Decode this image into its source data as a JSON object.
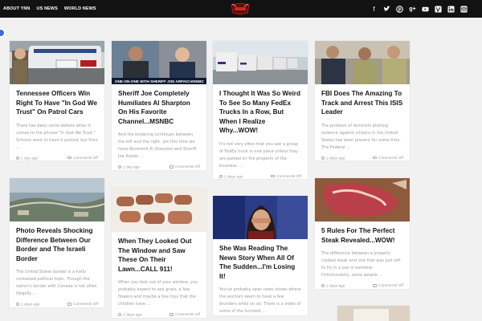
{
  "nav": {
    "items": [
      "ABOUT YNN",
      "US NEWS",
      "WORLD NEWS"
    ]
  },
  "logo": {
    "icon": "ynn-logo"
  },
  "social": [
    "facebook-icon",
    "twitter-icon",
    "pinterest-icon",
    "google-plus-icon",
    "youtube-icon",
    "vine-icon",
    "linkedin-icon",
    "email-icon"
  ],
  "articles": [
    {
      "title": "Tennessee Officers Win Right To Have \"In God We Trust\" On Patrol Cars",
      "excerpt": "There has been some debate when it comes to the phrase \"In God We Trust.\" Schools want to have it posted, but their ...",
      "date": "1 day ago",
      "comments": "Comments Off"
    },
    {
      "title": "Sheriff Joe Completely Humiliates Al Sharpton On His Favorite Channel...MSNBC",
      "thumb_caption": "ONE-ON-ONE WITH SHERIFF JOE ARPAIO",
      "thumb_logo": "MSNBC",
      "excerpt": "And the bickering continues between the left and the right, yet this time we have Reverend Al Sharpton and Sheriff Joe Arpaio ...",
      "date": "1 day ago",
      "comments": "Comments Off"
    },
    {
      "title": "I Thought It Was So Weird To See So Many FedEx Trucks In a Row, But When I Realize Why...WOW!",
      "excerpt": "It's not very often that you see a group of FedEx truck in one place unless they are parked on the property of the business. ...",
      "date": "2 days ago",
      "comments": "Comments Off"
    },
    {
      "title": "FBI Does The Amazing To Track and Arrest This ISIS Leader",
      "excerpt": "The problem of terrorists plotting violence against citizens in the United States has been present for some time. The Federal ...",
      "date": "2 days ago",
      "comments": "Comments Off"
    },
    {
      "title": "Photo Reveals Shocking Difference Between Our Border and The Israeli Border",
      "excerpt": "The United States border is a hotly contested political topic. Though the nation's border with Canada is not often illegally ...",
      "date": "2 days ago",
      "comments": "Comments Off"
    },
    {
      "title": "When They Looked Out The Window and Saw These On Their Lawn...CALL 911!",
      "excerpt": "When you look out of your window, you probably expect to see grass, a few flowers and maybe a few toys that the children have ...",
      "date": "2 days ago",
      "comments": "Comments Off"
    },
    {
      "title": "She Was Reading The News Story When All Of The Sudden...I'm Losing It!",
      "excerpt": "You've probably seen news shows where the anchors seem to have a few blunders while on air. There is a video of some of the funniest ...",
      "date": "",
      "comments": ""
    },
    {
      "title": "5 Rules For The Perfect Steak Revealed...WOW!",
      "excerpt": "The difference between a properly cooked steak and one that was just left to fry in a pan is extreme. Unfortunately, some people ...",
      "date": "2 days ago",
      "comments": "Comments Off"
    }
  ]
}
